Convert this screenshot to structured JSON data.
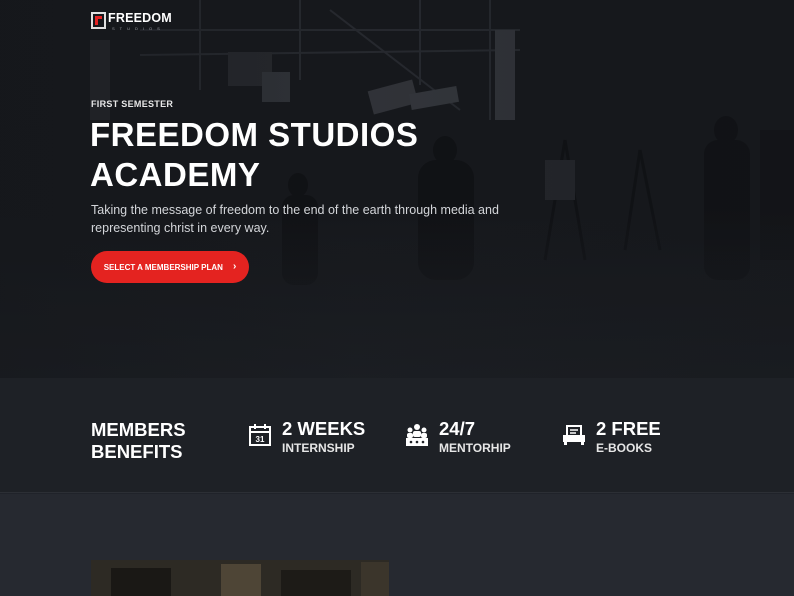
{
  "logo": {
    "word": "FREEDOM",
    "sub": "STUDIOS"
  },
  "hero": {
    "eyebrow": "FIRST SEMESTER",
    "title": "FREEDOM STUDIOS ACADEMY",
    "subtitle": "Taking the message of freedom to the end of the earth through media and representing christ in every way.",
    "cta_label": "SELECT A MEMBERSHIP PLAN",
    "cta_icon": "chevron-right-icon"
  },
  "benefits": {
    "heading": "MEMBERS BENEFITS",
    "items": [
      {
        "value": "2 WEEKS",
        "label": "INTERNSHIP",
        "icon": "calendar-icon"
      },
      {
        "value": "24/7",
        "label": "MENTORHIP",
        "icon": "group-icon"
      },
      {
        "value": "2 FREE",
        "label": "E-BOOKS",
        "icon": "printer-icon"
      }
    ]
  },
  "colors": {
    "accent": "#e42320",
    "background": "#20232a"
  }
}
